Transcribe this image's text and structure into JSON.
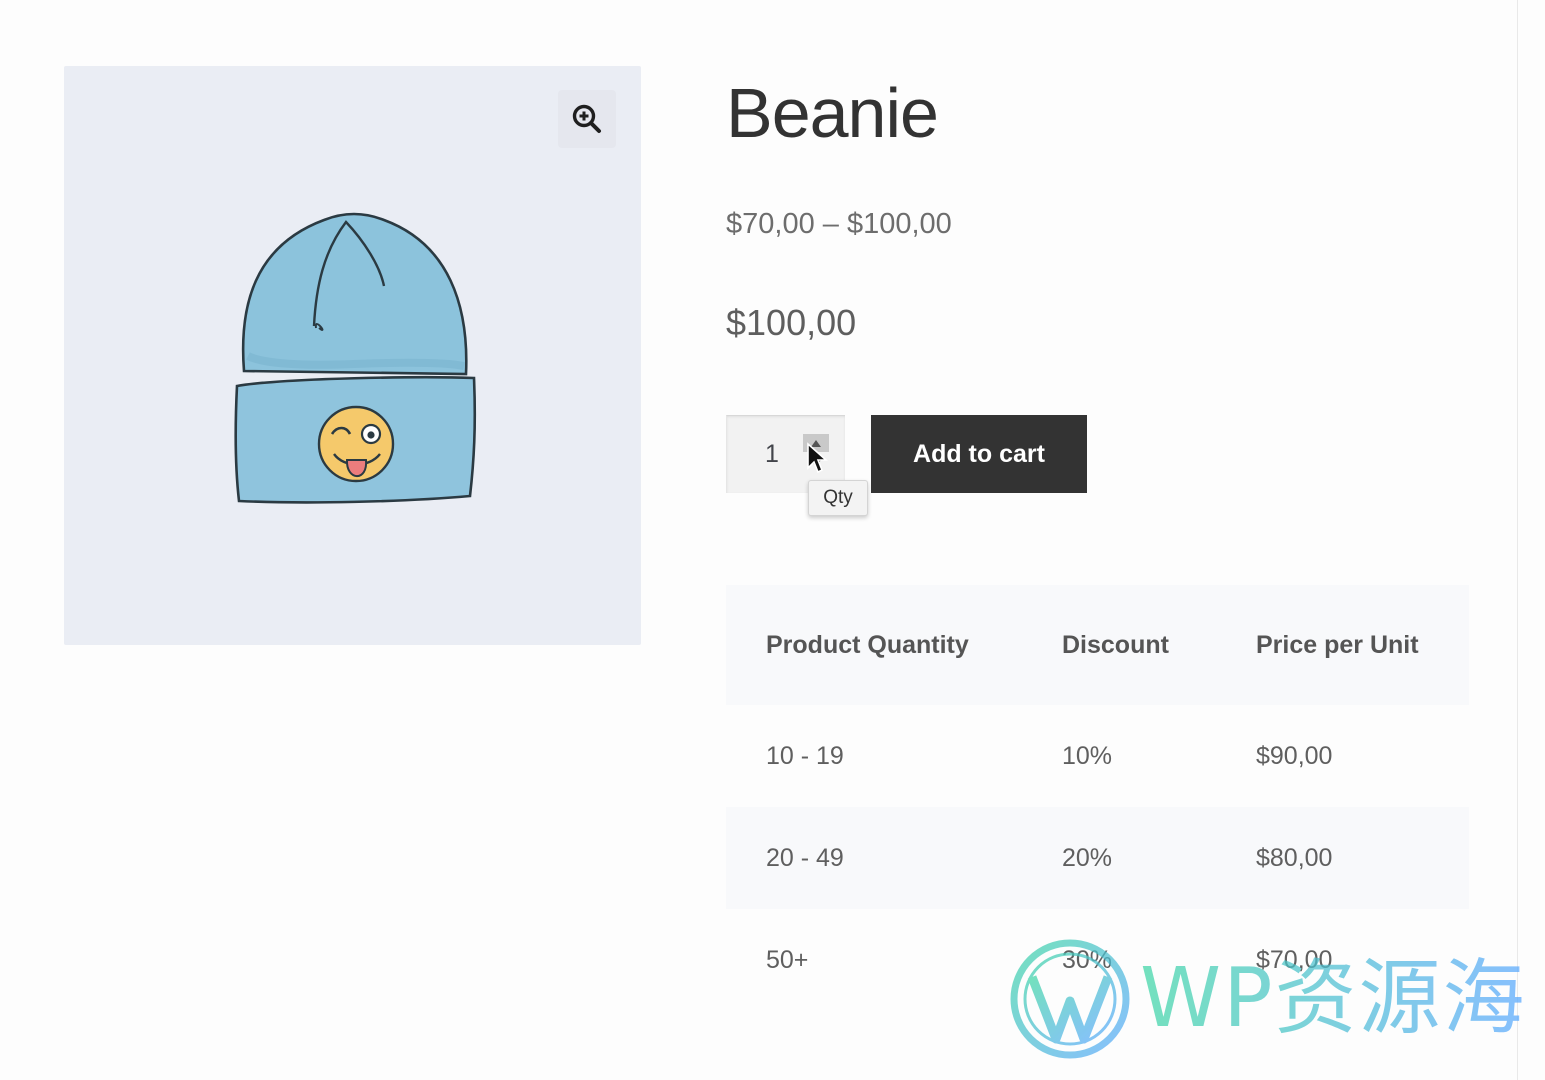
{
  "product": {
    "title": "Beanie",
    "price_range": "$70,00 – $100,00",
    "current_price": "$100,00",
    "image_icon": "beanie-illustration"
  },
  "gallery": {
    "zoom_icon": "zoom-in-icon"
  },
  "cart": {
    "quantity": "1",
    "tooltip": "Qty",
    "add_to_cart_label": "Add to cart"
  },
  "pricing_table": {
    "headers": [
      "Product Quantity",
      "Discount",
      "Price per Unit"
    ],
    "rows": [
      [
        "10 - 19",
        "10%",
        "$90,00"
      ],
      [
        "20 - 49",
        "20%",
        "$80,00"
      ],
      [
        "50+",
        "30%",
        "$70,00"
      ]
    ]
  },
  "watermark": {
    "text": "WP资源海",
    "icon": "wordpress-logo-icon"
  },
  "colors": {
    "button_bg": "#333333",
    "gallery_bg": "#eaedf4",
    "table_stripe": "#f8f9fb",
    "watermark_start": "#3fd6a6",
    "watermark_end": "#5aa8ff"
  }
}
